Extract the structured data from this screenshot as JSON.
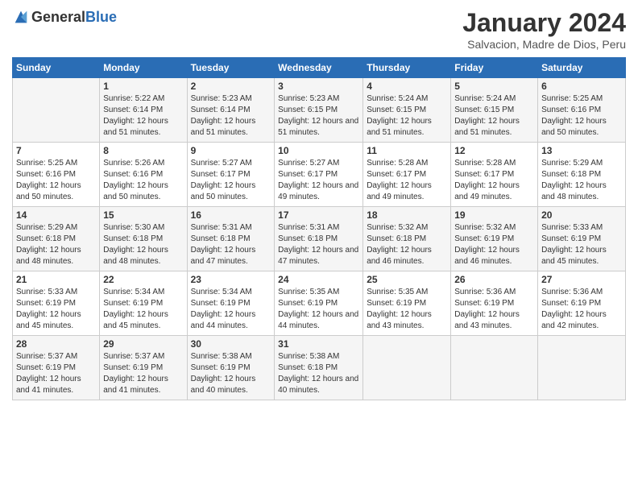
{
  "header": {
    "logo_general": "General",
    "logo_blue": "Blue",
    "month_title": "January 2024",
    "subtitle": "Salvacion, Madre de Dios, Peru"
  },
  "calendar": {
    "days_of_week": [
      "Sunday",
      "Monday",
      "Tuesday",
      "Wednesday",
      "Thursday",
      "Friday",
      "Saturday"
    ],
    "weeks": [
      [
        {
          "day": "",
          "info": ""
        },
        {
          "day": "1",
          "info": "Sunrise: 5:22 AM\nSunset: 6:14 PM\nDaylight: 12 hours and 51 minutes."
        },
        {
          "day": "2",
          "info": "Sunrise: 5:23 AM\nSunset: 6:14 PM\nDaylight: 12 hours and 51 minutes."
        },
        {
          "day": "3",
          "info": "Sunrise: 5:23 AM\nSunset: 6:15 PM\nDaylight: 12 hours and 51 minutes."
        },
        {
          "day": "4",
          "info": "Sunrise: 5:24 AM\nSunset: 6:15 PM\nDaylight: 12 hours and 51 minutes."
        },
        {
          "day": "5",
          "info": "Sunrise: 5:24 AM\nSunset: 6:15 PM\nDaylight: 12 hours and 51 minutes."
        },
        {
          "day": "6",
          "info": "Sunrise: 5:25 AM\nSunset: 6:16 PM\nDaylight: 12 hours and 50 minutes."
        }
      ],
      [
        {
          "day": "7",
          "info": "Sunrise: 5:25 AM\nSunset: 6:16 PM\nDaylight: 12 hours and 50 minutes."
        },
        {
          "day": "8",
          "info": "Sunrise: 5:26 AM\nSunset: 6:16 PM\nDaylight: 12 hours and 50 minutes."
        },
        {
          "day": "9",
          "info": "Sunrise: 5:27 AM\nSunset: 6:17 PM\nDaylight: 12 hours and 50 minutes."
        },
        {
          "day": "10",
          "info": "Sunrise: 5:27 AM\nSunset: 6:17 PM\nDaylight: 12 hours and 49 minutes."
        },
        {
          "day": "11",
          "info": "Sunrise: 5:28 AM\nSunset: 6:17 PM\nDaylight: 12 hours and 49 minutes."
        },
        {
          "day": "12",
          "info": "Sunrise: 5:28 AM\nSunset: 6:17 PM\nDaylight: 12 hours and 49 minutes."
        },
        {
          "day": "13",
          "info": "Sunrise: 5:29 AM\nSunset: 6:18 PM\nDaylight: 12 hours and 48 minutes."
        }
      ],
      [
        {
          "day": "14",
          "info": "Sunrise: 5:29 AM\nSunset: 6:18 PM\nDaylight: 12 hours and 48 minutes."
        },
        {
          "day": "15",
          "info": "Sunrise: 5:30 AM\nSunset: 6:18 PM\nDaylight: 12 hours and 48 minutes."
        },
        {
          "day": "16",
          "info": "Sunrise: 5:31 AM\nSunset: 6:18 PM\nDaylight: 12 hours and 47 minutes."
        },
        {
          "day": "17",
          "info": "Sunrise: 5:31 AM\nSunset: 6:18 PM\nDaylight: 12 hours and 47 minutes."
        },
        {
          "day": "18",
          "info": "Sunrise: 5:32 AM\nSunset: 6:18 PM\nDaylight: 12 hours and 46 minutes."
        },
        {
          "day": "19",
          "info": "Sunrise: 5:32 AM\nSunset: 6:19 PM\nDaylight: 12 hours and 46 minutes."
        },
        {
          "day": "20",
          "info": "Sunrise: 5:33 AM\nSunset: 6:19 PM\nDaylight: 12 hours and 45 minutes."
        }
      ],
      [
        {
          "day": "21",
          "info": "Sunrise: 5:33 AM\nSunset: 6:19 PM\nDaylight: 12 hours and 45 minutes."
        },
        {
          "day": "22",
          "info": "Sunrise: 5:34 AM\nSunset: 6:19 PM\nDaylight: 12 hours and 45 minutes."
        },
        {
          "day": "23",
          "info": "Sunrise: 5:34 AM\nSunset: 6:19 PM\nDaylight: 12 hours and 44 minutes."
        },
        {
          "day": "24",
          "info": "Sunrise: 5:35 AM\nSunset: 6:19 PM\nDaylight: 12 hours and 44 minutes."
        },
        {
          "day": "25",
          "info": "Sunrise: 5:35 AM\nSunset: 6:19 PM\nDaylight: 12 hours and 43 minutes."
        },
        {
          "day": "26",
          "info": "Sunrise: 5:36 AM\nSunset: 6:19 PM\nDaylight: 12 hours and 43 minutes."
        },
        {
          "day": "27",
          "info": "Sunrise: 5:36 AM\nSunset: 6:19 PM\nDaylight: 12 hours and 42 minutes."
        }
      ],
      [
        {
          "day": "28",
          "info": "Sunrise: 5:37 AM\nSunset: 6:19 PM\nDaylight: 12 hours and 41 minutes."
        },
        {
          "day": "29",
          "info": "Sunrise: 5:37 AM\nSunset: 6:19 PM\nDaylight: 12 hours and 41 minutes."
        },
        {
          "day": "30",
          "info": "Sunrise: 5:38 AM\nSunset: 6:19 PM\nDaylight: 12 hours and 40 minutes."
        },
        {
          "day": "31",
          "info": "Sunrise: 5:38 AM\nSunset: 6:18 PM\nDaylight: 12 hours and 40 minutes."
        },
        {
          "day": "",
          "info": ""
        },
        {
          "day": "",
          "info": ""
        },
        {
          "day": "",
          "info": ""
        }
      ]
    ]
  }
}
